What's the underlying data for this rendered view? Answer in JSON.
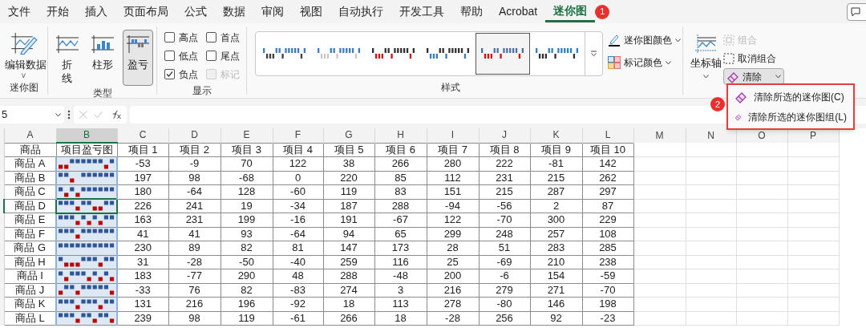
{
  "menu_tabs": [
    {
      "label": "文件",
      "selected": false
    },
    {
      "label": "开始",
      "selected": false
    },
    {
      "label": "插入",
      "selected": false
    },
    {
      "label": "页面布局",
      "selected": false
    },
    {
      "label": "公式",
      "selected": false
    },
    {
      "label": "数据",
      "selected": false
    },
    {
      "label": "审阅",
      "selected": false
    },
    {
      "label": "视图",
      "selected": false
    },
    {
      "label": "自动执行",
      "selected": false
    },
    {
      "label": "开发工具",
      "selected": false
    },
    {
      "label": "帮助",
      "selected": false
    },
    {
      "label": "Acrobat",
      "selected": false
    },
    {
      "label": "迷你图",
      "selected": true,
      "badge": "1"
    }
  ],
  "ribbon": {
    "sparkline_group": {
      "label": "迷你图",
      "edit_data": "编辑数据",
      "chevron": "˅"
    },
    "type_group": {
      "label": "类型",
      "types": [
        {
          "label": "折线",
          "kind": "line",
          "selected": false
        },
        {
          "label": "柱形",
          "kind": "column",
          "selected": false
        },
        {
          "label": "盈亏",
          "kind": "winloss",
          "selected": true
        }
      ]
    },
    "show_group": {
      "label": "显示",
      "options": [
        {
          "label": "高点",
          "checked": false,
          "disabled": false
        },
        {
          "label": "首点",
          "checked": false,
          "disabled": false
        },
        {
          "label": "低点",
          "checked": false,
          "disabled": false
        },
        {
          "label": "尾点",
          "checked": false,
          "disabled": false
        },
        {
          "label": "负点",
          "checked": true,
          "disabled": false
        },
        {
          "label": "标记",
          "checked": false,
          "disabled": true
        }
      ]
    },
    "style_group": {
      "label": "样式",
      "styles": [
        {
          "selected": false,
          "series": [
            {
              "kind": "win",
              "color": "#3a7cc4"
            },
            {
              "kind": "loss",
              "color": "#404040"
            }
          ]
        },
        {
          "selected": false,
          "series": [
            {
              "kind": "win",
              "color": "#3a7cc4"
            },
            {
              "kind": "loss",
              "color": "#c8c8c8"
            }
          ]
        },
        {
          "selected": false,
          "series": [
            {
              "kind": "win",
              "color": "#303030"
            },
            {
              "kind": "loss",
              "color": "#d01010"
            }
          ]
        },
        {
          "selected": false,
          "series": [
            {
              "kind": "win",
              "color": "#303030"
            },
            {
              "kind": "loss",
              "color": "#2f7fc8"
            }
          ]
        },
        {
          "selected": true,
          "series": [
            {
              "kind": "win",
              "color": "#4f6fa8"
            },
            {
              "kind": "loss",
              "color": "#d01010"
            }
          ]
        },
        {
          "selected": false,
          "series": [
            {
              "kind": "win",
              "color": "#2f7fc8"
            },
            {
              "kind": "loss",
              "color": "#303030"
            }
          ]
        }
      ],
      "sparkline_color": "迷你图颜色",
      "marker_color": "标记颜色"
    },
    "group_group": {
      "axis": "坐标轴",
      "group": "组合",
      "group_disabled": true,
      "ungroup": "取消组合",
      "clear": "清除"
    }
  },
  "clear_menu": {
    "badge": "2",
    "items": [
      "清除所选的迷你图(C)",
      "清除所选的迷你图组(L)"
    ]
  },
  "formula_bar": {
    "name_box": "5"
  },
  "sheet": {
    "columns": [
      {
        "label": "A",
        "selected": false
      },
      {
        "label": "B",
        "selected": true
      },
      {
        "label": "C",
        "selected": false
      },
      {
        "label": "D",
        "selected": false
      },
      {
        "label": "E",
        "selected": false
      },
      {
        "label": "F",
        "selected": false
      },
      {
        "label": "G",
        "selected": false
      },
      {
        "label": "H",
        "selected": false
      },
      {
        "label": "I",
        "selected": false
      },
      {
        "label": "J",
        "selected": false
      },
      {
        "label": "K",
        "selected": false
      },
      {
        "label": "L",
        "selected": false
      },
      {
        "label": "M",
        "selected": false
      },
      {
        "label": "N",
        "selected": false
      },
      {
        "label": "O",
        "selected": false
      },
      {
        "label": "P",
        "selected": false
      }
    ],
    "header": [
      "商品",
      "项目盈亏图",
      "项目 1",
      "项目 2",
      "项目 3",
      "项目 4",
      "项目 5",
      "项目 6",
      "项目 7",
      "项目 8",
      "项目 9",
      "项目 10"
    ],
    "sparkline": {
      "series": [
        {
          "kind": "win",
          "color": "#2f5597"
        },
        {
          "kind": "loss",
          "color": "#c00000"
        }
      ]
    },
    "rows": [
      {
        "name": "商品 A",
        "selected": false,
        "values": [
          "-53",
          "-9",
          "70",
          "122",
          "38",
          "266",
          "280",
          "222",
          "-81",
          "142"
        ]
      },
      {
        "name": "商品 B",
        "selected": false,
        "values": [
          "197",
          "98",
          "-68",
          "0",
          "220",
          "85",
          "112",
          "231",
          "215",
          "262"
        ]
      },
      {
        "name": "商品 C",
        "selected": false,
        "values": [
          "180",
          "-64",
          "128",
          "-60",
          "119",
          "83",
          "151",
          "215",
          "287",
          "297"
        ]
      },
      {
        "name": "商品 D",
        "selected": true,
        "values": [
          "226",
          "241",
          "19",
          "-34",
          "187",
          "288",
          "-94",
          "-56",
          "2",
          "87"
        ]
      },
      {
        "name": "商品 E",
        "selected": false,
        "values": [
          "163",
          "231",
          "199",
          "-16",
          "191",
          "-67",
          "122",
          "-70",
          "300",
          "229"
        ]
      },
      {
        "name": "商品 F",
        "selected": false,
        "values": [
          "41",
          "41",
          "93",
          "-64",
          "94",
          "65",
          "299",
          "248",
          "257",
          "108"
        ]
      },
      {
        "name": "商品 G",
        "selected": false,
        "values": [
          "230",
          "89",
          "82",
          "81",
          "147",
          "173",
          "28",
          "51",
          "283",
          "285"
        ]
      },
      {
        "name": "商品 H",
        "selected": false,
        "values": [
          "31",
          "-28",
          "-50",
          "-40",
          "259",
          "116",
          "25",
          "-69",
          "210",
          "238"
        ]
      },
      {
        "name": "商品 I",
        "selected": false,
        "values": [
          "183",
          "-77",
          "290",
          "48",
          "288",
          "-48",
          "200",
          "-6",
          "154",
          "-59"
        ]
      },
      {
        "name": "商品 J",
        "selected": false,
        "values": [
          "-33",
          "76",
          "82",
          "-83",
          "274",
          "3",
          "216",
          "279",
          "271",
          "-70"
        ]
      },
      {
        "name": "商品 K",
        "selected": false,
        "values": [
          "131",
          "216",
          "196",
          "-92",
          "18",
          "113",
          "278",
          "-80",
          "146",
          "198"
        ]
      },
      {
        "name": "商品 L",
        "selected": false,
        "values": [
          "239",
          "98",
          "119",
          "-61",
          "266",
          "18",
          "-28",
          "256",
          "92",
          "-23"
        ]
      }
    ]
  }
}
